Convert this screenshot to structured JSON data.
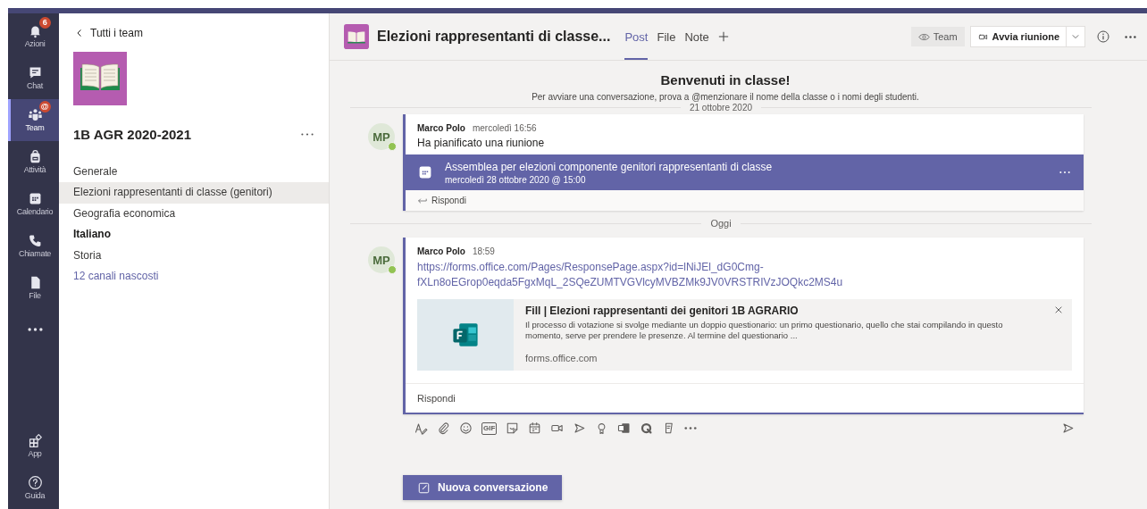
{
  "rail": {
    "items": [
      {
        "label": "Azioni",
        "kind": "bell",
        "selected": false,
        "badge": "6"
      },
      {
        "label": "Chat",
        "kind": "chat",
        "selected": false
      },
      {
        "label": "Team",
        "kind": "team",
        "selected": true,
        "badge": "@"
      },
      {
        "label": "Attività",
        "kind": "bag",
        "selected": false
      },
      {
        "label": "Calendario",
        "kind": "calendar",
        "selected": false
      },
      {
        "label": "Chiamate",
        "kind": "phone",
        "selected": false
      },
      {
        "label": "File",
        "kind": "file",
        "selected": false
      },
      {
        "kind": "more",
        "selected": false
      }
    ],
    "bottom": [
      {
        "label": "App",
        "kind": "apps",
        "selected": false
      },
      {
        "label": "Guida",
        "kind": "help",
        "selected": false
      }
    ]
  },
  "panel": {
    "back": "Tutti i team",
    "team_name": "1B AGR 2020-2021",
    "channels": [
      {
        "name": "Generale",
        "selected": false,
        "unread": false
      },
      {
        "name": "Elezioni rappresentanti di classe (genitori)",
        "selected": true,
        "unread": false
      },
      {
        "name": "Geografia economica",
        "selected": false,
        "unread": false
      },
      {
        "name": "Italiano",
        "selected": false,
        "unread": true
      },
      {
        "name": "Storia",
        "selected": false,
        "unread": false
      }
    ],
    "hidden_link": "12 canali nascosti"
  },
  "header": {
    "title": "Elezioni rappresentanti di classe...",
    "tabs": [
      {
        "label": "Post",
        "selected": true
      },
      {
        "label": "File",
        "selected": false
      },
      {
        "label": "Note",
        "selected": false
      }
    ],
    "team_button": "Team",
    "meet_button": "Avvia riunione"
  },
  "welcome": {
    "title": "Benvenuti in classe!",
    "text": "Per avviare una conversazione, prova a @menzionare il nome della classe o i nomi degli studenti.",
    "date": "21 ottobre 2020"
  },
  "threads": [
    {
      "kind": "meeting",
      "initials": "MP",
      "online": true,
      "author": "Marco Polo",
      "time": "mercoledì 16:56",
      "text": "Ha pianificato una riunione",
      "meeting": {
        "title": "Assemblea per elezioni componente genitori rappresentanti di classe",
        "when": "mercoledì 28 ottobre 2020 @ 15:00"
      },
      "reply": "Rispondi"
    },
    {
      "kind": "divider",
      "label": "Oggi"
    },
    {
      "kind": "link",
      "initials": "MP",
      "online": true,
      "author": "Marco Polo",
      "time": "18:59",
      "link": "https://forms.office.com/Pages/ResponsePage.aspx?id=lNiJEl_dG0Cmg-fXLn8oEGrop0eqda5FgxMqL_2SQeZUMTVGVlcyMVBZMk9JV0VRSTRIVzJOQkc2MS4u",
      "preview": {
        "title": "Fill | Elezioni rappresentanti dei genitori 1B AGRARIO",
        "description": "Il processo di votazione si svolge mediante un doppio questionario: un primo questionario, quello che stai compilando in questo momento, serve per prendere le presenze. Al termine del questionario ...",
        "domain": "forms.office.com"
      },
      "compose": {
        "placeholder": "Rispondi",
        "tools": [
          {
            "kind": "format"
          },
          {
            "kind": "attach"
          },
          {
            "kind": "emoji"
          },
          {
            "kind": "gif",
            "text": "GIF"
          },
          {
            "kind": "sticker"
          },
          {
            "kind": "schedule"
          },
          {
            "kind": "meet"
          },
          {
            "kind": "stream"
          },
          {
            "kind": "praise"
          },
          {
            "kind": "forms"
          },
          {
            "kind": "quiz"
          },
          {
            "kind": "notes"
          },
          {
            "kind": "dots"
          }
        ]
      }
    }
  ],
  "new_button": "Nuova conversazione"
}
